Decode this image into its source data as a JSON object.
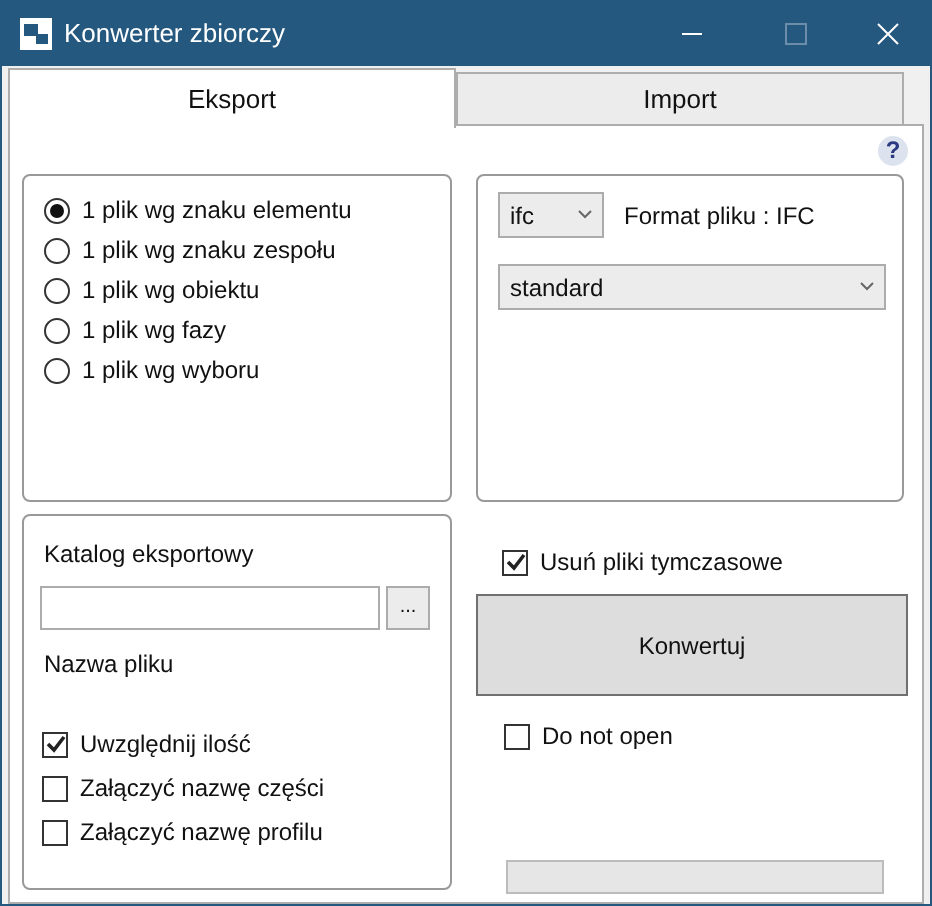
{
  "window": {
    "title": "Konwerter zbiorczy"
  },
  "tabs": [
    {
      "label": "Eksport",
      "selected": true
    },
    {
      "label": "Import",
      "selected": false
    }
  ],
  "help": {
    "label": "?"
  },
  "split_options": [
    {
      "label": "1 plik wg znaku elementu",
      "selected": true
    },
    {
      "label": "1 plik wg znaku zespołu",
      "selected": false
    },
    {
      "label": "1 plik wg obiektu",
      "selected": false
    },
    {
      "label": "1 plik wg fazy",
      "selected": false
    },
    {
      "label": "1 plik wg wyboru",
      "selected": false
    }
  ],
  "format": {
    "dropdown_value": "ifc",
    "label": "Format pliku : IFC",
    "profile_value": "standard"
  },
  "export": {
    "catalog_label": "Katalog eksportowy",
    "browse_label": "...",
    "file_name_label": "Nazwa pliku"
  },
  "name_options": [
    {
      "label": "Uwzględnij ilość",
      "checked": true
    },
    {
      "label": "Załączyć nazwę części",
      "checked": false
    },
    {
      "label": "Załączyć nazwę profilu",
      "checked": false
    }
  ],
  "delete_temp": {
    "label": "Usuń pliki tymczasowe",
    "checked": true
  },
  "convert_button": "Konwertuj",
  "do_not_open": {
    "label": "Do not open",
    "checked": false
  },
  "progress": {
    "level": 0
  }
}
